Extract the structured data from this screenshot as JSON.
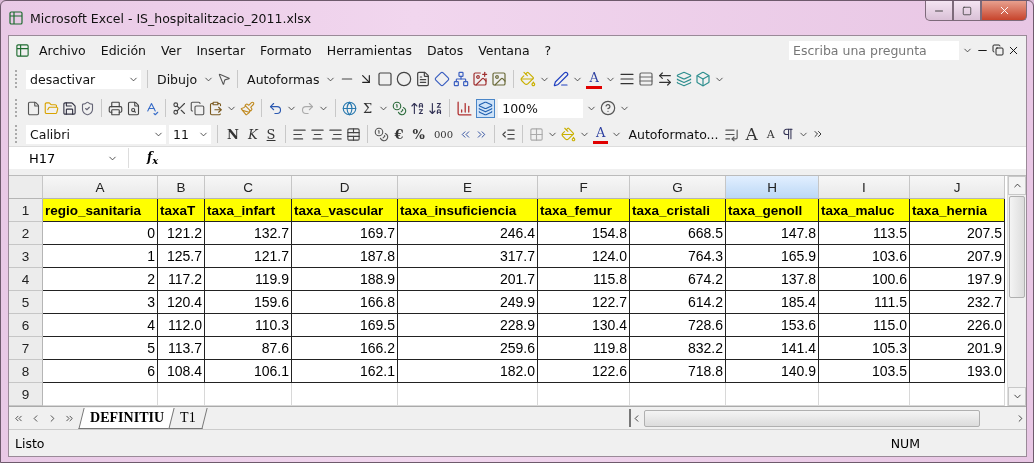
{
  "window": {
    "title": "Microsoft Excel - IS_hospitalitzacio_2011.xlsx"
  },
  "menu": [
    "Archivo",
    "Edición",
    "Ver",
    "Insertar",
    "Formato",
    "Herramientas",
    "Datos",
    "Ventana",
    "?"
  ],
  "question_box": {
    "placeholder": "Escriba una pregunta"
  },
  "drawing_toolbar": {
    "style_box": "desactivar",
    "draw_menu": "Dibujo",
    "autoshapes_menu": "Autoformas",
    "font_color_label": "A"
  },
  "standard_toolbar": {
    "sum_label": "Σ",
    "zoom": "100%"
  },
  "format_toolbar": {
    "font": "Calibri",
    "size": "11",
    "bold": "N",
    "italic": "K",
    "underline": "S",
    "euro": "€",
    "percent": "%",
    "thousands": "000",
    "font_color_label": "A",
    "autoformat": "Autoformato...",
    "grow_font": "A",
    "shrink_font": "A"
  },
  "formula_bar": {
    "name_box": "H17",
    "fx": "f$_{x}$"
  },
  "sheet": {
    "columns": [
      {
        "letter": "A",
        "selected": false
      },
      {
        "letter": "B",
        "selected": false
      },
      {
        "letter": "C",
        "selected": false
      },
      {
        "letter": "D",
        "selected": false
      },
      {
        "letter": "E",
        "selected": false
      },
      {
        "letter": "F",
        "selected": false
      },
      {
        "letter": "G",
        "selected": false
      },
      {
        "letter": "H",
        "selected": true
      },
      {
        "letter": "I",
        "selected": false
      },
      {
        "letter": "J",
        "selected": false
      }
    ],
    "rows": [
      {
        "number": "1",
        "kind": "header",
        "cells": [
          "regio_sanitaria",
          "taxaT",
          "taxa_infart",
          "taxa_vascular",
          "taxa_insuficiencia",
          "taxa_femur",
          "taxa_cristali",
          "taxa_genoll",
          "taxa_maluc",
          "taxa_hernia"
        ]
      },
      {
        "number": "2",
        "kind": "data",
        "cells": [
          "0",
          "121.2",
          "132.7",
          "169.7",
          "246.4",
          "154.8",
          "668.5",
          "147.8",
          "113.5",
          "207.5"
        ]
      },
      {
        "number": "3",
        "kind": "data",
        "cells": [
          "1",
          "125.7",
          "121.7",
          "187.8",
          "317.7",
          "124.0",
          "764.3",
          "165.9",
          "103.6",
          "207.9"
        ]
      },
      {
        "number": "4",
        "kind": "data",
        "cells": [
          "2",
          "117.2",
          "119.9",
          "188.9",
          "201.7",
          "115.8",
          "674.2",
          "137.8",
          "100.6",
          "197.9"
        ]
      },
      {
        "number": "5",
        "kind": "data",
        "cells": [
          "3",
          "120.4",
          "159.6",
          "166.8",
          "249.9",
          "122.7",
          "614.2",
          "185.4",
          "111.5",
          "232.7"
        ]
      },
      {
        "number": "6",
        "kind": "data",
        "cells": [
          "4",
          "112.0",
          "110.3",
          "169.5",
          "228.9",
          "130.4",
          "728.6",
          "153.6",
          "115.0",
          "226.0"
        ]
      },
      {
        "number": "7",
        "kind": "data",
        "cells": [
          "5",
          "113.7",
          "87.6",
          "166.2",
          "259.6",
          "119.8",
          "832.2",
          "141.4",
          "105.3",
          "201.9"
        ]
      },
      {
        "number": "8",
        "kind": "data",
        "cells": [
          "6",
          "108.4",
          "106.1",
          "162.1",
          "182.0",
          "122.6",
          "718.8",
          "140.9",
          "103.5",
          "193.0"
        ]
      },
      {
        "number": "9",
        "kind": "blank"
      }
    ]
  },
  "sheet_tabs": [
    {
      "label": "DEFINITIU",
      "selected": true
    },
    {
      "label": "T1",
      "selected": false
    }
  ],
  "status_bar": {
    "status": "Listo",
    "num_lock": "NUM"
  }
}
